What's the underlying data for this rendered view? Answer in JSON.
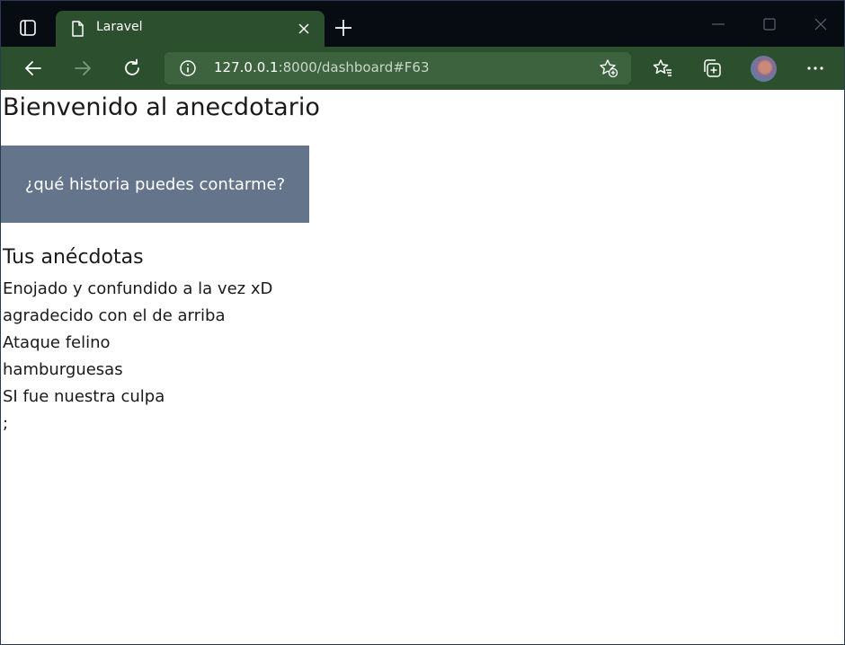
{
  "browser": {
    "tab": {
      "title": "Laravel"
    },
    "address": {
      "host": "127.0.0.1",
      "path": ":8000/dashboard#F63"
    }
  },
  "page": {
    "title": "Bienvenido al anecdotario",
    "cta_label": "¿qué historia puedes contarme?",
    "section_title": "Tus anécdotas",
    "anecdotes": [
      "Enojado y confundido a la vez xD",
      "agradecido con el de arriba",
      "Ataque felino",
      "hamburguesas",
      "SI fue nuestra culpa",
      ";"
    ]
  },
  "colors": {
    "titlebar": "#070c12",
    "toolbar": "#2c4f2e",
    "addressbar": "#3c633e",
    "button": "#64748b"
  }
}
